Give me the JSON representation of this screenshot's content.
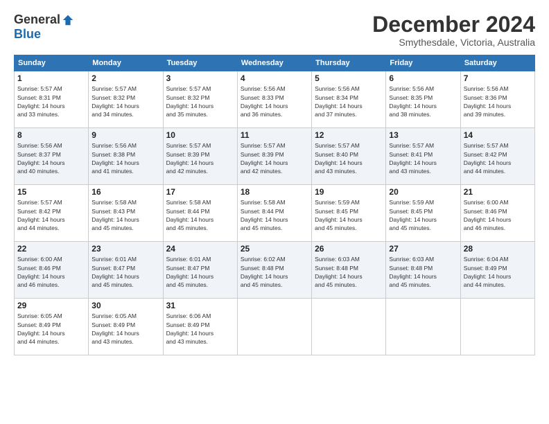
{
  "logo": {
    "general": "General",
    "blue": "Blue"
  },
  "title": "December 2024",
  "location": "Smythesdale, Victoria, Australia",
  "weekdays": [
    "Sunday",
    "Monday",
    "Tuesday",
    "Wednesday",
    "Thursday",
    "Friday",
    "Saturday"
  ],
  "weeks": [
    [
      {
        "day": "1",
        "sunrise": "5:57 AM",
        "sunset": "8:31 PM",
        "daylight": "14 hours and 33 minutes."
      },
      {
        "day": "2",
        "sunrise": "5:57 AM",
        "sunset": "8:32 PM",
        "daylight": "14 hours and 34 minutes."
      },
      {
        "day": "3",
        "sunrise": "5:57 AM",
        "sunset": "8:32 PM",
        "daylight": "14 hours and 35 minutes."
      },
      {
        "day": "4",
        "sunrise": "5:56 AM",
        "sunset": "8:33 PM",
        "daylight": "14 hours and 36 minutes."
      },
      {
        "day": "5",
        "sunrise": "5:56 AM",
        "sunset": "8:34 PM",
        "daylight": "14 hours and 37 minutes."
      },
      {
        "day": "6",
        "sunrise": "5:56 AM",
        "sunset": "8:35 PM",
        "daylight": "14 hours and 38 minutes."
      },
      {
        "day": "7",
        "sunrise": "5:56 AM",
        "sunset": "8:36 PM",
        "daylight": "14 hours and 39 minutes."
      }
    ],
    [
      {
        "day": "8",
        "sunrise": "5:56 AM",
        "sunset": "8:37 PM",
        "daylight": "14 hours and 40 minutes."
      },
      {
        "day": "9",
        "sunrise": "5:56 AM",
        "sunset": "8:38 PM",
        "daylight": "14 hours and 41 minutes."
      },
      {
        "day": "10",
        "sunrise": "5:57 AM",
        "sunset": "8:39 PM",
        "daylight": "14 hours and 42 minutes."
      },
      {
        "day": "11",
        "sunrise": "5:57 AM",
        "sunset": "8:39 PM",
        "daylight": "14 hours and 42 minutes."
      },
      {
        "day": "12",
        "sunrise": "5:57 AM",
        "sunset": "8:40 PM",
        "daylight": "14 hours and 43 minutes."
      },
      {
        "day": "13",
        "sunrise": "5:57 AM",
        "sunset": "8:41 PM",
        "daylight": "14 hours and 43 minutes."
      },
      {
        "day": "14",
        "sunrise": "5:57 AM",
        "sunset": "8:42 PM",
        "daylight": "14 hours and 44 minutes."
      }
    ],
    [
      {
        "day": "15",
        "sunrise": "5:57 AM",
        "sunset": "8:42 PM",
        "daylight": "14 hours and 44 minutes."
      },
      {
        "day": "16",
        "sunrise": "5:58 AM",
        "sunset": "8:43 PM",
        "daylight": "14 hours and 45 minutes."
      },
      {
        "day": "17",
        "sunrise": "5:58 AM",
        "sunset": "8:44 PM",
        "daylight": "14 hours and 45 minutes."
      },
      {
        "day": "18",
        "sunrise": "5:58 AM",
        "sunset": "8:44 PM",
        "daylight": "14 hours and 45 minutes."
      },
      {
        "day": "19",
        "sunrise": "5:59 AM",
        "sunset": "8:45 PM",
        "daylight": "14 hours and 45 minutes."
      },
      {
        "day": "20",
        "sunrise": "5:59 AM",
        "sunset": "8:45 PM",
        "daylight": "14 hours and 45 minutes."
      },
      {
        "day": "21",
        "sunrise": "6:00 AM",
        "sunset": "8:46 PM",
        "daylight": "14 hours and 46 minutes."
      }
    ],
    [
      {
        "day": "22",
        "sunrise": "6:00 AM",
        "sunset": "8:46 PM",
        "daylight": "14 hours and 46 minutes."
      },
      {
        "day": "23",
        "sunrise": "6:01 AM",
        "sunset": "8:47 PM",
        "daylight": "14 hours and 45 minutes."
      },
      {
        "day": "24",
        "sunrise": "6:01 AM",
        "sunset": "8:47 PM",
        "daylight": "14 hours and 45 minutes."
      },
      {
        "day": "25",
        "sunrise": "6:02 AM",
        "sunset": "8:48 PM",
        "daylight": "14 hours and 45 minutes."
      },
      {
        "day": "26",
        "sunrise": "6:03 AM",
        "sunset": "8:48 PM",
        "daylight": "14 hours and 45 minutes."
      },
      {
        "day": "27",
        "sunrise": "6:03 AM",
        "sunset": "8:48 PM",
        "daylight": "14 hours and 45 minutes."
      },
      {
        "day": "28",
        "sunrise": "6:04 AM",
        "sunset": "8:49 PM",
        "daylight": "14 hours and 44 minutes."
      }
    ],
    [
      {
        "day": "29",
        "sunrise": "6:05 AM",
        "sunset": "8:49 PM",
        "daylight": "14 hours and 44 minutes."
      },
      {
        "day": "30",
        "sunrise": "6:05 AM",
        "sunset": "8:49 PM",
        "daylight": "14 hours and 43 minutes."
      },
      {
        "day": "31",
        "sunrise": "6:06 AM",
        "sunset": "8:49 PM",
        "daylight": "14 hours and 43 minutes."
      },
      null,
      null,
      null,
      null
    ]
  ],
  "labels": {
    "sunrise": "Sunrise:",
    "sunset": "Sunset:",
    "daylight": "Daylight:"
  }
}
